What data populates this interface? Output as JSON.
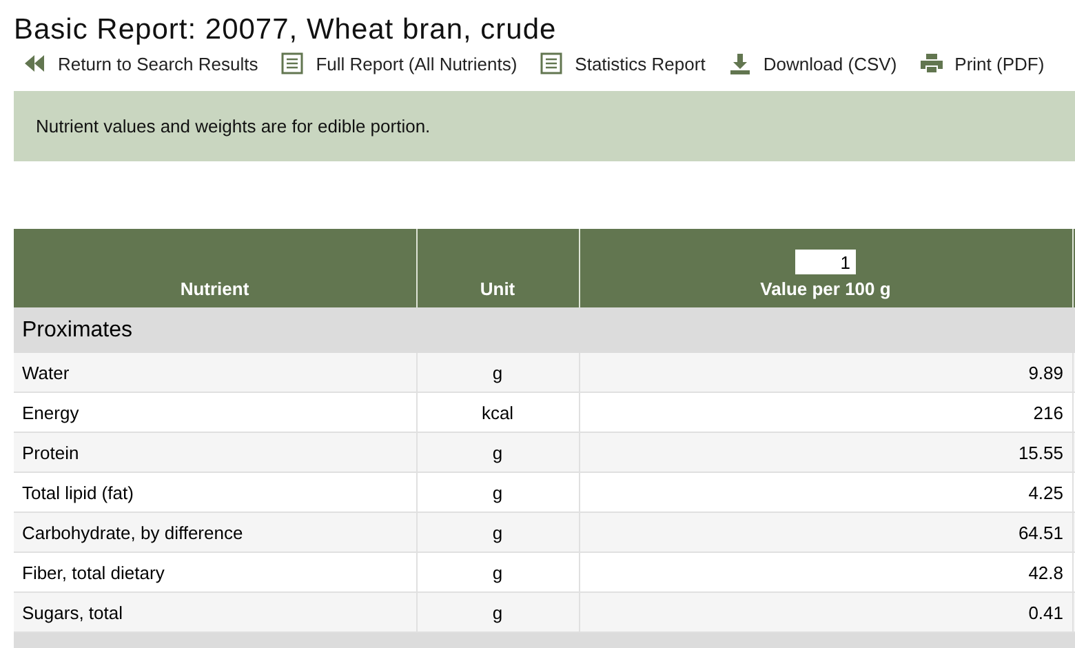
{
  "title": "Basic Report:  20077, Wheat bran, crude",
  "toolbar": [
    {
      "kind": "back",
      "label": "Return to Search Results"
    },
    {
      "kind": "list",
      "label": "Full Report (All Nutrients)"
    },
    {
      "kind": "list",
      "label": "Statistics Report"
    },
    {
      "kind": "download",
      "label": "Download (CSV)"
    },
    {
      "kind": "print",
      "label": "Print (PDF)"
    }
  ],
  "notice": "Nutrient values and weights are for edible portion.",
  "table": {
    "columns": [
      "Nutrient",
      "Unit",
      "Value per 100 g"
    ],
    "quantity_field": {
      "value": "1"
    },
    "groups": [
      {
        "name": "Proximates",
        "rows": [
          {
            "nutrient": "Water",
            "unit": "g",
            "value": "9.89"
          },
          {
            "nutrient": "Energy",
            "unit": "kcal",
            "value": "216"
          },
          {
            "nutrient": "Protein",
            "unit": "g",
            "value": "15.55"
          },
          {
            "nutrient": "Total lipid (fat)",
            "unit": "g",
            "value": "4.25"
          },
          {
            "nutrient": "Carbohydrate, by difference",
            "unit": "g",
            "value": "64.51"
          },
          {
            "nutrient": "Fiber, total dietary",
            "unit": "g",
            "value": "42.8"
          },
          {
            "nutrient": "Sugars, total",
            "unit": "g",
            "value": "0.41"
          }
        ]
      }
    ]
  }
}
